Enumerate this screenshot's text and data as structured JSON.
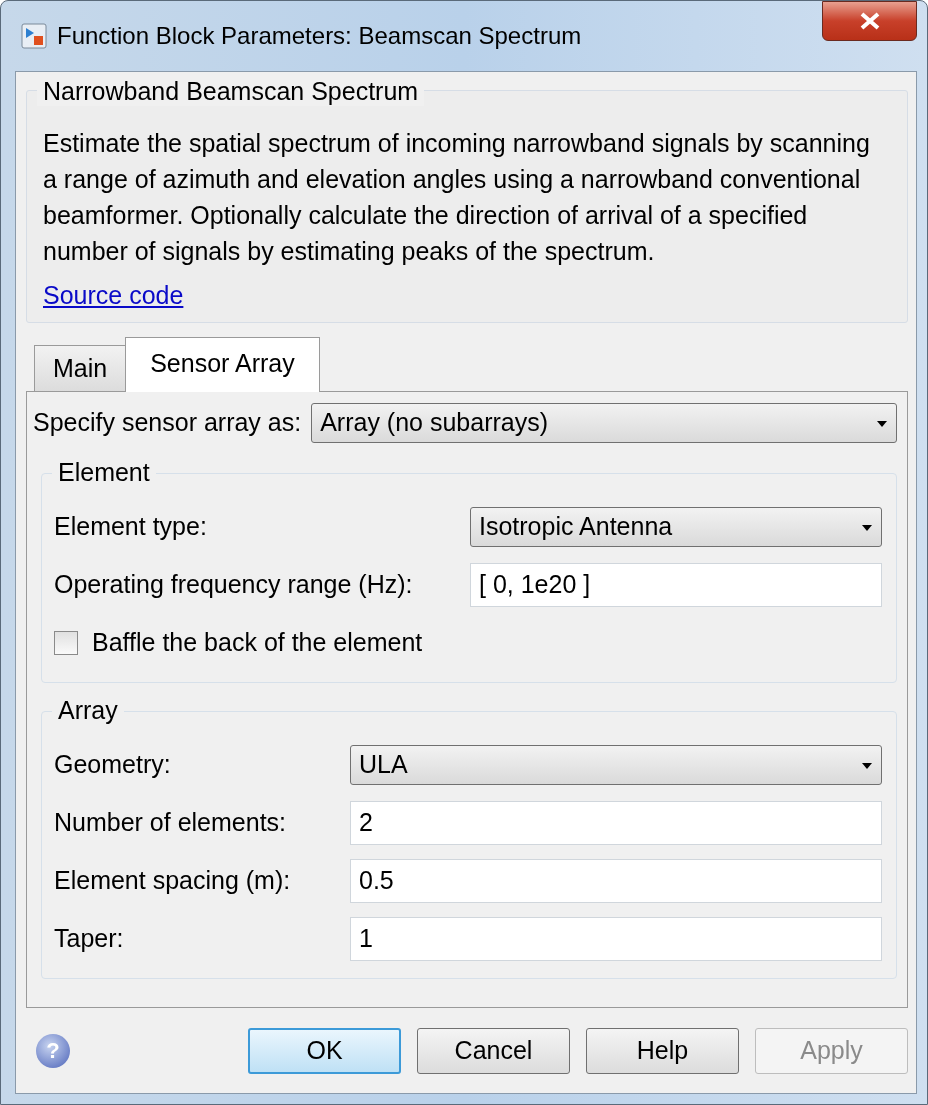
{
  "window": {
    "title": "Function Block Parameters: Beamscan Spectrum"
  },
  "description": {
    "title": "Narrowband Beamscan Spectrum",
    "text": "Estimate the spatial spectrum of incoming narrowband signals by scanning a range of azimuth and elevation angles using a narrowband conventional beamformer. Optionally calculate the direction of arrival of a specified number of signals by estimating peaks of the spectrum.",
    "link": "Source code"
  },
  "tabs": [
    {
      "label": "Main",
      "selected": false
    },
    {
      "label": "Sensor Array",
      "selected": true
    }
  ],
  "specify": {
    "label": "Specify sensor array as:",
    "value": "Array (no subarrays)"
  },
  "groups": [
    {
      "title": "Element",
      "wide": true,
      "params": [
        {
          "kind": "dropdown",
          "label": "Element type:",
          "value": "Isotropic Antenna"
        },
        {
          "kind": "text",
          "label": "Operating frequency range (Hz):",
          "value": "[ 0, 1e20 ]"
        },
        {
          "kind": "checkbox",
          "label": "Baffle the back of the element",
          "checked": false
        }
      ]
    },
    {
      "title": "Array",
      "wide": false,
      "params": [
        {
          "kind": "dropdown",
          "label": "Geometry:",
          "value": "ULA"
        },
        {
          "kind": "text",
          "label": "Number of elements:",
          "value": "2"
        },
        {
          "kind": "text",
          "label": "Element spacing (m):",
          "value": "0.5"
        },
        {
          "kind": "text",
          "label": "Taper:",
          "value": "1"
        }
      ]
    }
  ],
  "help_glyph": "?",
  "buttons": [
    {
      "label": "OK",
      "default": true,
      "disabled": false
    },
    {
      "label": "Cancel",
      "default": false,
      "disabled": false
    },
    {
      "label": "Help",
      "default": false,
      "disabled": false
    },
    {
      "label": "Apply",
      "default": false,
      "disabled": true
    }
  ]
}
